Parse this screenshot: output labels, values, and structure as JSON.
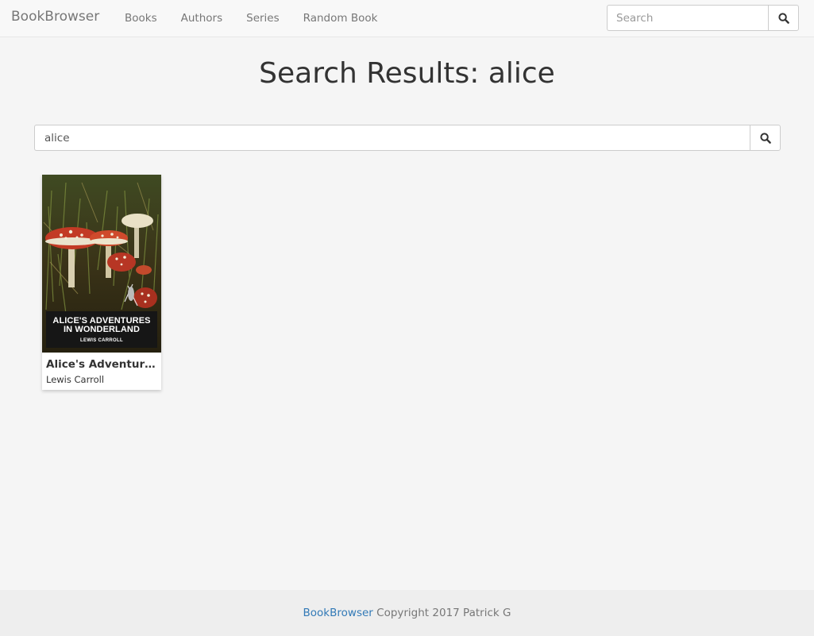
{
  "navbar": {
    "brand": "BookBrowser",
    "links": [
      "Books",
      "Authors",
      "Series",
      "Random Book"
    ],
    "search_placeholder": "Search",
    "search_value": ""
  },
  "page": {
    "title": "Search Results: alice",
    "search_value": "alice"
  },
  "results": [
    {
      "title": "Alice's Adventures...",
      "author": "Lewis Carroll",
      "cover_title_line1": "ALICE'S ADVENTURES",
      "cover_title_line2": "IN WONDERLAND",
      "cover_author": "LEWIS CARROLL"
    }
  ],
  "footer": {
    "link": "BookBrowser",
    "text": "Copyright 2017 Patrick G"
  },
  "icons": {
    "search": "search-icon"
  },
  "colors": {
    "link": "#337ab7",
    "navbar_bg": "#f8f8f8",
    "page_bg": "#f5f5f5"
  }
}
